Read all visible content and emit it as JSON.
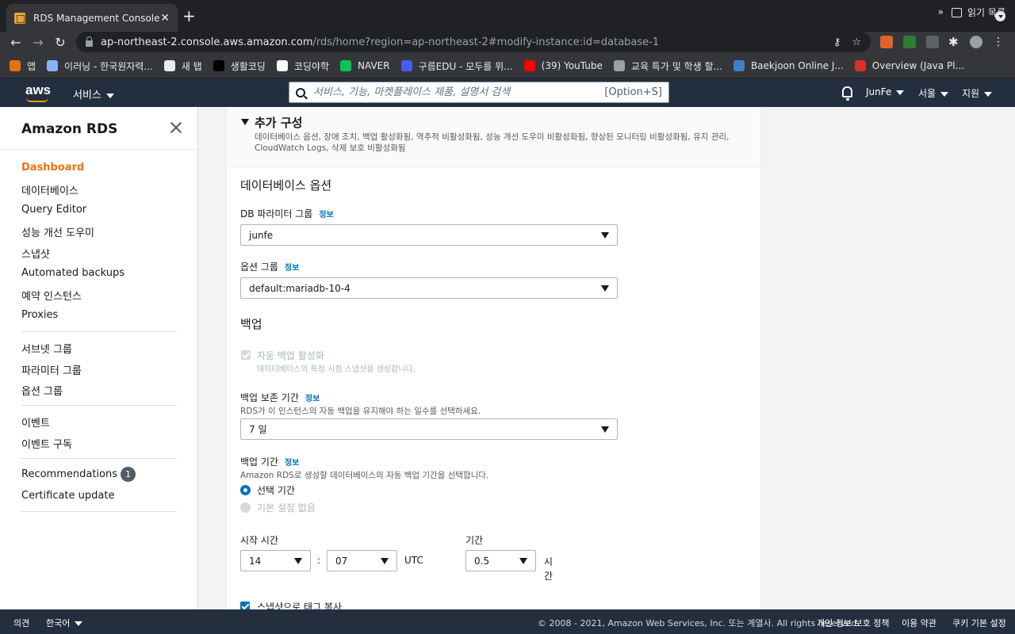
{
  "browser": {
    "tab_title": "RDS Management Console",
    "tab_close": "✕",
    "new_tab": "+",
    "url_host": "ap-northeast-2.console.aws.amazon.com",
    "url_path": "/rds/home?region=ap-northeast-2#modify-instance:id=database-1",
    "bookmarks": [
      {
        "label": "앱",
        "color": "#e8710a"
      },
      {
        "label": "이러닝 - 한국원자력...",
        "color": "#8ab4f8"
      },
      {
        "label": "새 탭",
        "color": "#e8eaed"
      },
      {
        "label": "생활코딩",
        "color": "#000000"
      },
      {
        "label": "코딩야학",
        "color": "#ffffff"
      },
      {
        "label": "NAVER",
        "color": "#03c75a"
      },
      {
        "label": "구름EDU - 모두를 위...",
        "color": "#4a5cf0"
      },
      {
        "label": "(39) YouTube",
        "color": "#ff0000"
      },
      {
        "label": "교육 특가 및 학생 할...",
        "color": "#9aa0a6"
      },
      {
        "label": "Baekjoon Online J...",
        "color": "#3b82c4"
      },
      {
        "label": "Overview (Java Pl...",
        "color": "#d93025"
      }
    ],
    "bookmarks_more": "»",
    "reading_list": "읽기 목록"
  },
  "aws_header": {
    "logo": "aws",
    "services": "서비스",
    "search_placeholder": "서비스, 기능, 마켓플레이스 제품, 설명서 검색",
    "search_shortcut": "[Option+S]",
    "user": "JunFe",
    "region": "서울",
    "support": "지원"
  },
  "sidebar": {
    "title": "Amazon RDS",
    "items_group1": [
      "Dashboard",
      "데이터베이스",
      "Query Editor",
      "성능 개선 도우미",
      "스냅샷",
      "Automated backups",
      "예약 인스턴스",
      "Proxies"
    ],
    "items_group2": [
      "서브넷 그룹",
      "파라미터 그룹",
      "옵션 그룹"
    ],
    "items_group3": [
      "이벤트",
      "이벤트 구독"
    ],
    "recommendations": "Recommendations",
    "recommendations_count": "1",
    "certificate": "Certificate update"
  },
  "main": {
    "extra_title": "추가 구성",
    "extra_desc": "데이터베이스 옵션, 장애 조치, 백업 활성화됨, 역추적 비활성화됨, 성능 개선 도우미 비활성화됨, 향상된 모니터링 비활성화됨, 유지 관리, CloudWatch Logs, 삭제 보호 비활성화됨",
    "db_options_title": "데이터베이스 옵션",
    "param_group_label": "DB 파라미터 그룹",
    "param_group_value": "junfe",
    "option_group_label": "옵션 그룹",
    "option_group_value": "default:mariadb-10-4",
    "info": "정보",
    "backup_title": "백업",
    "auto_backup_label": "자동 백업 활성화",
    "auto_backup_desc": "데이터베이스의 특정 시점 스냅샷을 생성합니다.",
    "retention_label": "백업 보존 기간",
    "retention_desc": "RDS가 이 인스턴스의 자동 백업을 유지해야 하는 일수를 선택하세요.",
    "retention_value": "7 일",
    "window_label": "백업 기간",
    "window_desc": "Amazon RDS로 생성할 데이터베이스의 자동 백업 기간을 선택합니다.",
    "window_option_select": "선택 기간",
    "window_option_none": "기본 설정 없음",
    "start_time_label": "시작 시간",
    "start_hour": "14",
    "colon": ":",
    "start_minute": "07",
    "utc": "UTC",
    "duration_label": "기간",
    "duration_value": "0.5",
    "hours_unit_1": "시",
    "hours_unit_2": "간",
    "copy_tags_label": "스냅샷으로 태그 복사"
  },
  "footer": {
    "feedback": "의견",
    "language": "한국어",
    "copyright": "© 2008 - 2021, Amazon Web Services, Inc. 또는 계열사. All rights reserved.",
    "privacy": "개인 정보 보호 정책",
    "terms": "이용 약관",
    "cookies": "쿠키 기본 설정"
  }
}
